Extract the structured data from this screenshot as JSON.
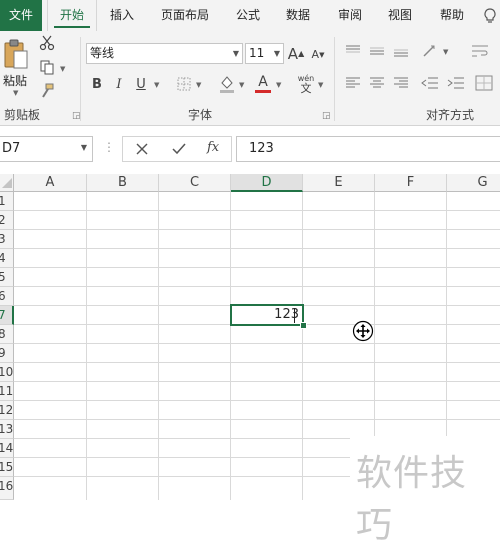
{
  "tabs": [
    "文件",
    "开始",
    "插入",
    "页面布局",
    "公式",
    "数据",
    "审阅",
    "视图",
    "帮助"
  ],
  "ribbon": {
    "clipboard": {
      "paste_label": "粘贴",
      "group_label": "剪贴板"
    },
    "font": {
      "font_name": "等线",
      "font_size": "11",
      "group_label": "字体",
      "bold": "B",
      "italic": "I",
      "underline": "U",
      "grow": "A",
      "shrink": "A",
      "font_color_glyph": "A",
      "phonetic_top": "wén",
      "phonetic_bottom": "文"
    },
    "alignment": {
      "group_label": "对齐方式"
    }
  },
  "formula_bar": {
    "name_box": "D7",
    "fx_label": "fx",
    "value": "123"
  },
  "grid": {
    "columns": [
      "A",
      "B",
      "C",
      "D",
      "E",
      "F",
      "G"
    ],
    "rows": [
      "1",
      "2",
      "3",
      "4",
      "5",
      "6",
      "7",
      "8",
      "9",
      "10",
      "11",
      "12",
      "13",
      "14",
      "15",
      "16"
    ],
    "selected_column": "D",
    "selected_row": "7",
    "active_cell_value": "123"
  },
  "watermark": "软件技巧",
  "colors": {
    "accent": "#217346",
    "ribbon_bg": "#f3f3f3",
    "font_color_bar": "#d42a2a"
  }
}
